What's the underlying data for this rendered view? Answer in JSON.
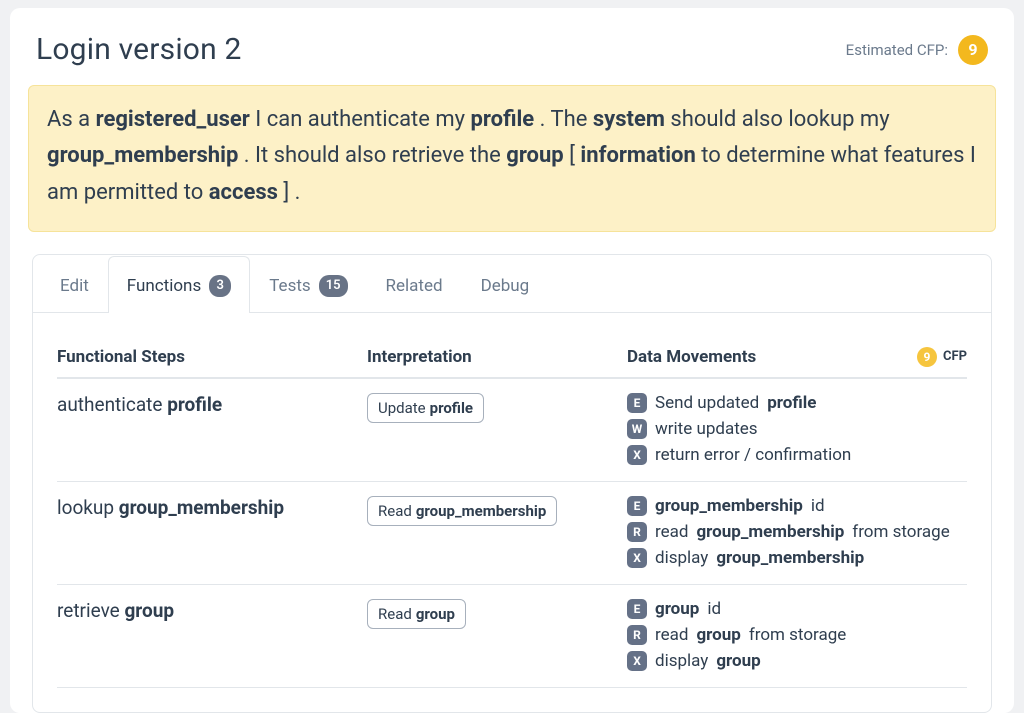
{
  "header": {
    "title": "Login version 2",
    "estimated_label": "Estimated CFP:",
    "estimated_value": "9"
  },
  "story": {
    "parts": [
      {
        "t": "As a "
      },
      {
        "t": "registered_user",
        "b": true
      },
      {
        "t": " I can authenticate my "
      },
      {
        "t": "profile",
        "b": true
      },
      {
        "t": " . The "
      },
      {
        "t": "system",
        "b": true
      },
      {
        "t": " should also lookup my "
      },
      {
        "t": "group_membership",
        "b": true
      },
      {
        "t": " . It should also retrieve the "
      },
      {
        "t": "group",
        "b": true
      },
      {
        "t": " [ "
      },
      {
        "t": "information",
        "b": true
      },
      {
        "t": " to determine what features I am permitted to "
      },
      {
        "t": "access",
        "b": true
      },
      {
        "t": " ] ."
      }
    ]
  },
  "tabs": {
    "edit": "Edit",
    "functions": "Functions",
    "functions_count": "3",
    "tests": "Tests",
    "tests_count": "15",
    "related": "Related",
    "debug": "Debug"
  },
  "table": {
    "head": {
      "steps": "Functional Steps",
      "interpretation": "Interpretation",
      "movements": "Data Movements",
      "cfp_badge": "9",
      "cfp_label": "CFP"
    },
    "rows": [
      {
        "verb": "authenticate",
        "noun": "profile",
        "interp_verb": "Update",
        "interp_noun": "profile",
        "movements": [
          {
            "code": "E",
            "pre": "Send updated ",
            "bold": "profile",
            "post": ""
          },
          {
            "code": "W",
            "pre": "write updates",
            "bold": "",
            "post": ""
          },
          {
            "code": "X",
            "pre": "return error / confirmation",
            "bold": "",
            "post": ""
          }
        ]
      },
      {
        "verb": "lookup",
        "noun": "group_membership",
        "interp_verb": "Read",
        "interp_noun": "group_membership",
        "movements": [
          {
            "code": "E",
            "pre": "",
            "bold": "group_membership",
            "post": " id"
          },
          {
            "code": "R",
            "pre": "read ",
            "bold": "group_membership",
            "post": " from storage"
          },
          {
            "code": "X",
            "pre": "display ",
            "bold": "group_membership",
            "post": ""
          }
        ]
      },
      {
        "verb": "retrieve",
        "noun": "group",
        "interp_verb": "Read",
        "interp_noun": "group",
        "movements": [
          {
            "code": "E",
            "pre": "",
            "bold": "group",
            "post": " id"
          },
          {
            "code": "R",
            "pre": "read ",
            "bold": "group",
            "post": " from storage"
          },
          {
            "code": "X",
            "pre": "display ",
            "bold": "group",
            "post": ""
          }
        ]
      }
    ]
  }
}
